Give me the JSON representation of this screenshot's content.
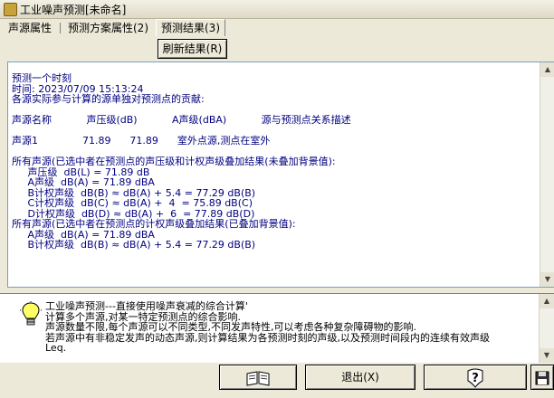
{
  "window": {
    "title": "工业噪声预测[未命名]",
    "icon": "app-icon"
  },
  "tabs": [
    {
      "label": "声源属性",
      "active": false
    },
    {
      "label": "预测方案属性(2)",
      "active": false
    },
    {
      "label": "预测结果(3)",
      "active": true
    }
  ],
  "refresh_button": {
    "label": "刷新结果(R)"
  },
  "results": {
    "lines": [
      "预测一个时刻",
      "时间: 2023/07/09 15:13:24",
      "各源实际参与计算的源单独对预测点的贡献:",
      "",
      "声源名称           声压级(dB)           A声级(dBA)           源与预测点关系描述",
      "",
      "声源1              71.89      71.89      室外点源,测点在室外",
      "",
      "所有声源(已选中者在预测点的声压级和计权声级叠加结果(未叠加背景值):",
      "     声压级  dB(L) = 71.89 dB",
      "     A声级  dB(A) = 71.89 dBA",
      "     B计权声级  dB(B) ≈ dB(A) + 5.4 = 77.29 dB(B)",
      "     C计权声级  dB(C) ≈ dB(A) +  4  = 75.89 dB(C)",
      "     D计权声级  dB(D) ≈ dB(A) +  6  = 77.89 dB(D)",
      "所有声源(已选中者在预测点的计权声级叠加结果(已叠加背景值):",
      "     A声级  dB(A) = 71.89 dBA",
      "     B计权声级  dB(B) ≈ dB(A) + 5.4 = 77.29 dB(B)"
    ]
  },
  "hint": {
    "icon": "lightbulb-icon",
    "lines": [
      "工业噪声预测---直接使用噪声衰减的综合计算'",
      "计算多个声源,对某一特定预测点的综合影响.",
      "声源数量不限,每个声源可以不同类型,不同发声特性,可以考虑各种复杂障碍物的影响.",
      "若声源中有非稳定发声的动态声源,则计算结果为各预测时刻的声级,以及预测时间段内的连续有效声级",
      "Leq."
    ]
  },
  "bottom_buttons": {
    "help_icon": "book-icon",
    "exit_label": "退出(X)",
    "query_icon": "question-icon",
    "save_icon": "floppy-disk-icon"
  }
}
